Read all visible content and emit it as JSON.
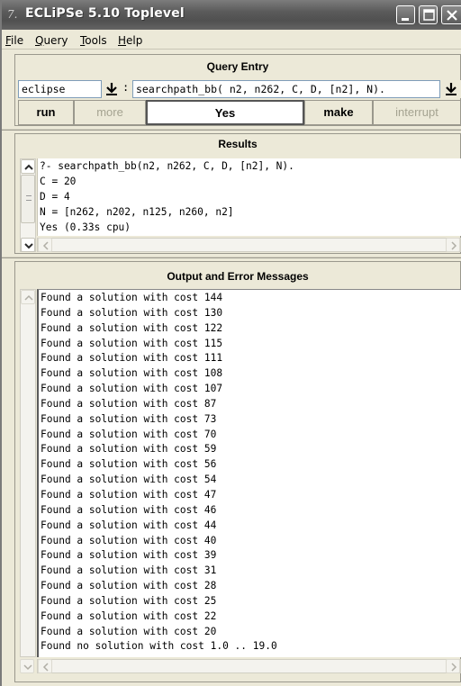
{
  "window": {
    "title": "ECLiPSe 5.10 Toplevel"
  },
  "menu": {
    "file": "File",
    "query": "Query",
    "tools": "Tools",
    "help": "Help"
  },
  "query_entry": {
    "heading": "Query Entry",
    "module": "eclipse",
    "separator": ":",
    "query": "searchpath_bb( n2, n262, C, D, [n2], N).",
    "buttons": {
      "run": "run",
      "more": "more",
      "yes": "Yes",
      "make": "make",
      "interrupt": "interrupt"
    }
  },
  "results": {
    "heading": "Results",
    "lines": [
      "?- searchpath_bb(n2, n262, C, D, [n2], N).",
      "C = 20",
      "D = 4",
      "N = [n262, n202, n125, n260, n2]",
      "Yes (0.33s cpu)"
    ]
  },
  "output": {
    "heading": "Output and Error Messages",
    "lines": [
      "Found a solution with cost 144",
      "Found a solution with cost 130",
      "Found a solution with cost 122",
      "Found a solution with cost 115",
      "Found a solution with cost 111",
      "Found a solution with cost 108",
      "Found a solution with cost 107",
      "Found a solution with cost 87",
      "Found a solution with cost 73",
      "Found a solution with cost 70",
      "Found a solution with cost 59",
      "Found a solution with cost 56",
      "Found a solution with cost 54",
      "Found a solution with cost 47",
      "Found a solution with cost 46",
      "Found a solution with cost 44",
      "Found a solution with cost 40",
      "Found a solution with cost 39",
      "Found a solution with cost 31",
      "Found a solution with cost 28",
      "Found a solution with cost 25",
      "Found a solution with cost 22",
      "Found a solution with cost 20",
      "Found no solution with cost 1.0 .. 19.0"
    ]
  }
}
